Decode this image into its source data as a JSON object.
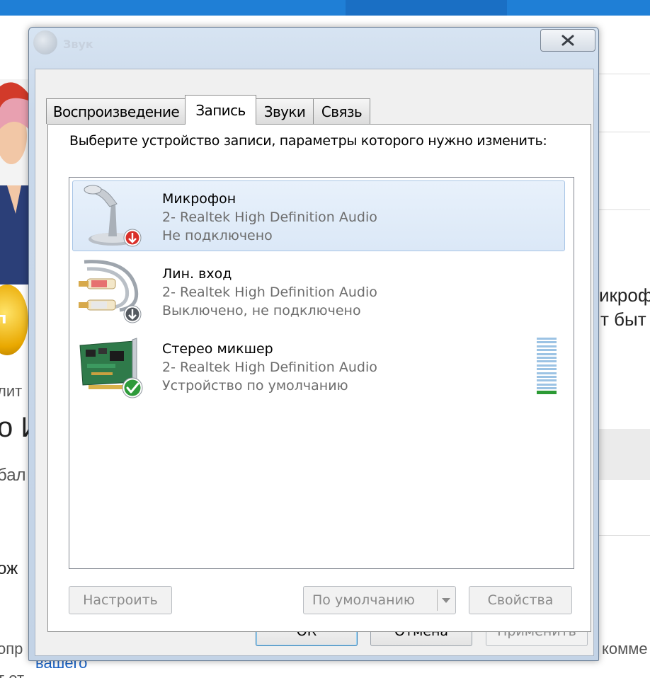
{
  "background": {
    "left_badge": "уп",
    "left_texts": [
      "лит",
      "о И",
      "бал",
      "ож",
      "опр",
      "т от "
    ],
    "link_text": "вашего",
    "right_texts": [
      "икроф",
      "т быт",
      "комме"
    ]
  },
  "dialog": {
    "title": "Звук",
    "close_icon": "close-icon",
    "tabs": [
      {
        "label": "Воспроизведение",
        "active": false
      },
      {
        "label": "Запись",
        "active": true
      },
      {
        "label": "Звуки",
        "active": false
      },
      {
        "label": "Связь",
        "active": false
      }
    ],
    "prompt": "Выберите устройство записи, параметры которого нужно изменить:",
    "devices": [
      {
        "name": "Микрофон",
        "driver": "2- Realtek High Definition Audio",
        "status": "Не подключено",
        "icon": "microphone-icon",
        "badge": "red-down-arrow-icon",
        "selected": true
      },
      {
        "name": "Лин. вход",
        "driver": "2- Realtek High Definition Audio",
        "status": "Выключено, не подключено",
        "icon": "line-in-cable-icon",
        "badge": "gray-down-arrow-icon",
        "selected": false
      },
      {
        "name": "Стерео микшер",
        "driver": "2- Realtek High Definition Audio",
        "status": "Устройство по умолчанию",
        "icon": "sound-card-icon",
        "badge": "green-check-icon",
        "selected": false,
        "level_fraction": 0.07
      }
    ],
    "buttons": {
      "configure": "Настроить",
      "set_default": "По умолчанию",
      "properties": "Свойства",
      "ok": "ОК",
      "cancel": "Отмена",
      "apply": "Применить"
    },
    "colors": {
      "selection": "#dbe8f7",
      "level_active": "#2c9a34",
      "level_idle": "#9cc3e4"
    }
  }
}
